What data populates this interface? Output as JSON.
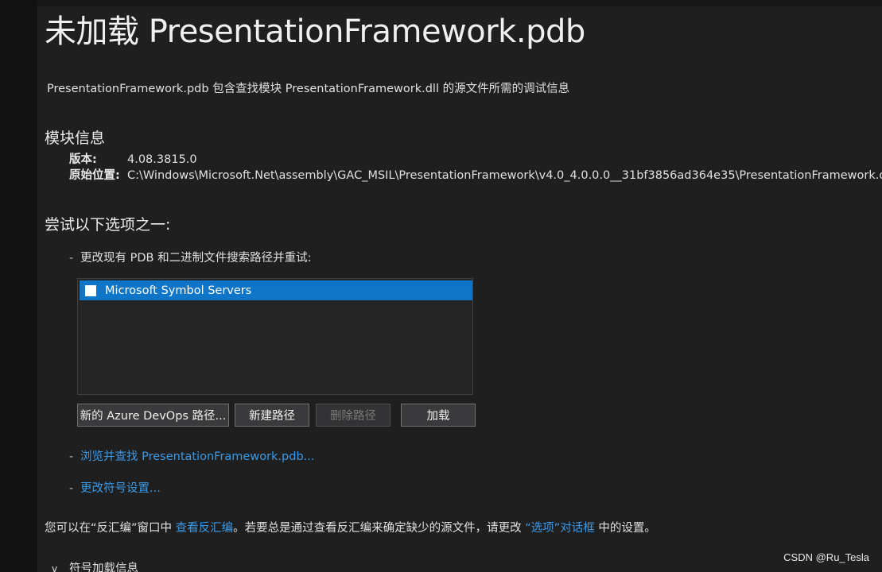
{
  "header": {
    "title": "未加载 PresentationFramework.pdb",
    "description": "PresentationFramework.pdb 包含查找模块 PresentationFramework.dll 的源文件所需的调试信息"
  },
  "module_info": {
    "heading": "模块信息",
    "version_label": "版本:",
    "version_value": "4.08.3815.0",
    "location_label": "原始位置:",
    "location_value": "C:\\Windows\\Microsoft.Net\\assembly\\GAC_MSIL\\PresentationFramework\\v4.0_4.0.0.0__31bf3856ad364e35\\PresentationFramework.dll"
  },
  "options": {
    "heading": "尝试以下选项之一:",
    "dash": "-",
    "change_paths_text": "更改现有 PDB 和二进制文件搜索路径并重试:",
    "symbol_servers": [
      {
        "label": "Microsoft Symbol Servers",
        "checked": false,
        "selected": true
      }
    ],
    "buttons": {
      "new_azure": "新的 Azure DevOps 路径...",
      "new_path": "新建路径",
      "delete_path": "删除路径",
      "load": "加载"
    },
    "browse_link": "浏览并查找 PresentationFramework.pdb...",
    "symbol_settings_link": "更改符号设置..."
  },
  "footer": {
    "part1": "您可以在“反汇编”窗口中 ",
    "link1": "查看反汇编",
    "part2": "。若要总是通过查看反汇编来确定缺少的源文件，请更改 ",
    "link2": "“选项”对话框",
    "part3": " 中的设置。"
  },
  "symbol_load_info": {
    "chevron": "v",
    "label": "符号加载信息"
  },
  "watermark": "CSDN @Ru_Tesla",
  "colors": {
    "link": "#3b9ae8",
    "selection": "#0e75c9",
    "background": "#1f1f1f"
  }
}
